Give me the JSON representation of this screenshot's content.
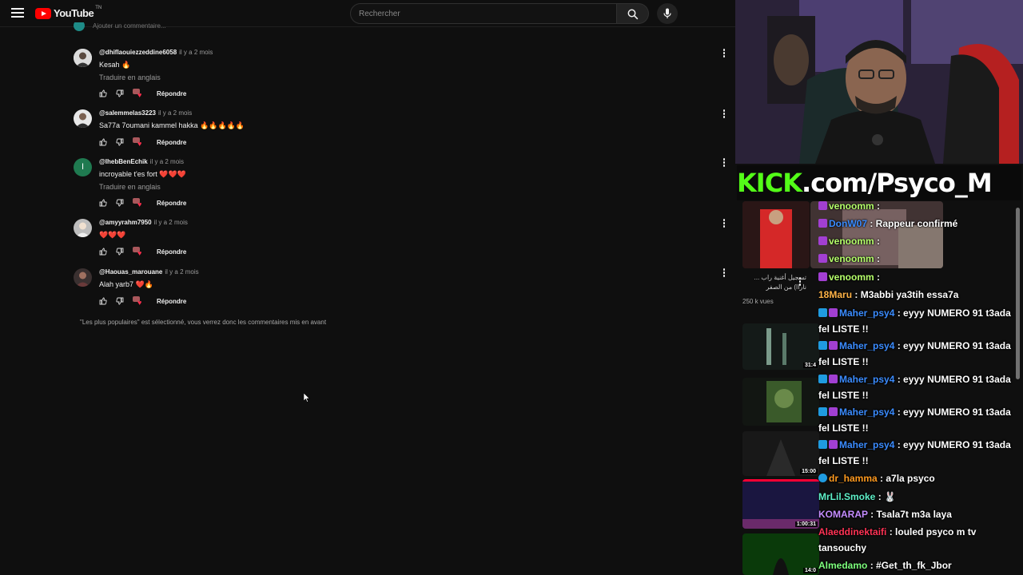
{
  "header": {
    "logo_text": "YouTube",
    "logo_super": "TN",
    "search_placeholder": "Rechercher"
  },
  "partial_row_text": "Ajouter un commentaire...",
  "comments": [
    {
      "user": "@dhiflaouiezzeddine6058",
      "time": "il y a 2 mois",
      "text": "Kesah 🔥",
      "translate": "Traduire en anglais",
      "reply": "Répondre"
    },
    {
      "user": "@salemmelas3223",
      "time": "il y a 2 mois",
      "text": "Sa77a 7oumani kammel hakka 🔥🔥🔥🔥🔥",
      "translate": "",
      "reply": "Répondre"
    },
    {
      "user": "@IhebBenEchik",
      "time": "il y a 2 mois",
      "text": "incroyable t'es fort ❤️❤️❤️",
      "translate": "Traduire en anglais",
      "reply": "Répondre",
      "initial": "I"
    },
    {
      "user": "@amyyrahm7950",
      "time": "il y a 2 mois",
      "text": "❤️❤️❤️",
      "translate": "",
      "reply": "Répondre"
    },
    {
      "user": "@Haouas_marouane",
      "time": "il y a 2 mois",
      "text": "Alah yarb7 ❤️🔥",
      "translate": "",
      "reply": "Répondre"
    }
  ],
  "notice": "\"Les plus populaires\" est sélectionné, vous verrez donc les commentaires mis en avant",
  "overlay": {
    "banner_prefix": "KICK",
    "banner_rest": ".com/Psyco_M"
  },
  "side_videos": [
    {
      "title": "تسجيل أغنية راب ... ناراا) من الصفر",
      "views": "250 k vues",
      "duration": ""
    },
    {
      "title": "",
      "views": "",
      "duration": "31:4"
    },
    {
      "title": "",
      "views": "",
      "duration": ""
    },
    {
      "title": "",
      "views": "",
      "duration": "15:00"
    },
    {
      "title": "",
      "views": "",
      "duration": "1:00:31"
    },
    {
      "title": "",
      "views": "",
      "duration": "14:0"
    }
  ],
  "chat": [
    {
      "user": "venoomm",
      "msg": " : ",
      "color": "#b6ff6b",
      "badge": "#a23fd2"
    },
    {
      "user": "DonW07",
      "msg": " : Rappeur confirmé",
      "color": "#3b8cff",
      "badge": "#a23fd2"
    },
    {
      "user": "venoomm",
      "msg": " : ",
      "color": "#b6ff6b",
      "badge": "#a23fd2"
    },
    {
      "user": "venoomm",
      "msg": " : ",
      "color": "#b6ff6b",
      "badge": "#a23fd2"
    },
    {
      "user": "venoomm",
      "msg": " : ",
      "color": "#b6ff6b",
      "badge": "#a23fd2"
    },
    {
      "user": "18Maru",
      "msg": " : M3abbi ya3tih essa7a",
      "color": "#ffb347",
      "badge": ""
    },
    {
      "user": "Maher_psy4",
      "msg": " : eyyy NUMERO 91 t3ada fel LISTE !!",
      "color": "#3b8cff",
      "badge": "#1f9be0"
    },
    {
      "user": "Maher_psy4",
      "msg": " : eyyy NUMERO 91 t3ada fel LISTE !!",
      "color": "#3b8cff",
      "badge": "#1f9be0"
    },
    {
      "user": "Maher_psy4",
      "msg": " : eyyy NUMERO 91 t3ada fel LISTE !!",
      "color": "#3b8cff",
      "badge": "#1f9be0"
    },
    {
      "user": "Maher_psy4",
      "msg": " : eyyy NUMERO 91 t3ada fel LISTE !!",
      "color": "#3b8cff",
      "badge": "#1f9be0"
    },
    {
      "user": "Maher_psy4",
      "msg": " : eyyy NUMERO 91 t3ada fel LISTE !!",
      "color": "#3b8cff",
      "badge": "#1f9be0"
    },
    {
      "user": "dr_hamma",
      "msg": " : a7la psyco",
      "color": "#ff9a1f",
      "badge": "#1f9be0"
    },
    {
      "user": "MrLil.Smoke",
      "msg": " : 🐰",
      "color": "#5ef0c8",
      "badge": ""
    },
    {
      "user": "KOMARAP",
      "msg": " : Tsala7t m3a laya",
      "color": "#c48cff",
      "badge": ""
    },
    {
      "user": "Alaeddinektaifi",
      "msg": " : louled psyco m tv tansouchy",
      "color": "#ff3355",
      "badge": ""
    },
    {
      "user": "Almedamo",
      "msg": " : #Get_th_fk_Jbor",
      "color": "#7dff7d",
      "badge": ""
    }
  ]
}
